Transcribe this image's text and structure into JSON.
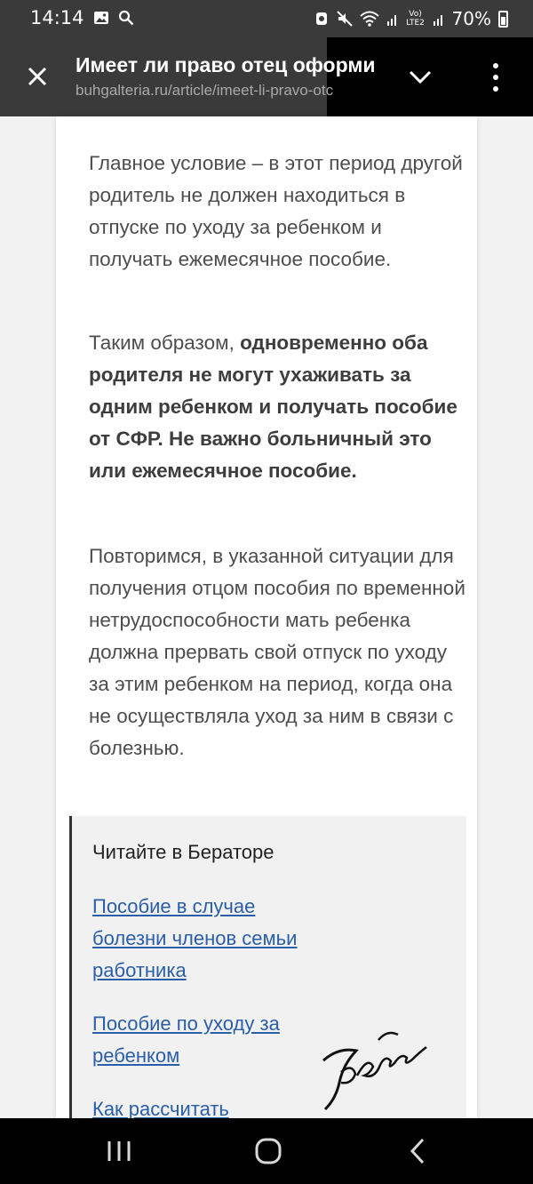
{
  "status_bar": {
    "time": "14:14",
    "network_label": "Vo) LTE2",
    "battery": "70%"
  },
  "toolbar": {
    "title": "Имеет ли право отец оформи",
    "url": "buhgalteria.ru/article/imeet-li-pravo-otc"
  },
  "article": {
    "p1": "Главное условие – в этот период другой родитель не должен находиться в отпуске по уходу за ребенком и получать ежемесячное пособие.",
    "p2_start": "Таким образом, ",
    "p2_bold": "одновременно оба родителя не могут ухаживать за одним ребенком и получать пособие от СФР. Не важно больничный это или ежемесячное пособие.",
    "p3": "Повторимся, в указанной ситуации для получения отцом пособия по временной нетрудоспособности мать ребенка должна прервать свой отпуск по уходу за этим ребенком на период, когда она не осуществляла уход за ним в связи с болезнью."
  },
  "read_box": {
    "heading": "Читайте в Бераторе",
    "links": [
      "Пособие в случае болезни членов семьи работника",
      "Пособие по уходу за ребенком",
      "Как рассчитать"
    ],
    "signature_text": "Бератор"
  },
  "colors": {
    "toolbar_bg": "#3a3a3a",
    "link": "#2a5ea8",
    "body_text": "#4d4d4d"
  },
  "icons": [
    "image-icon",
    "search-icon",
    "close-icon",
    "chevron-down-icon",
    "more-vert-icon",
    "recent-apps-icon",
    "home-icon",
    "back-icon"
  ]
}
